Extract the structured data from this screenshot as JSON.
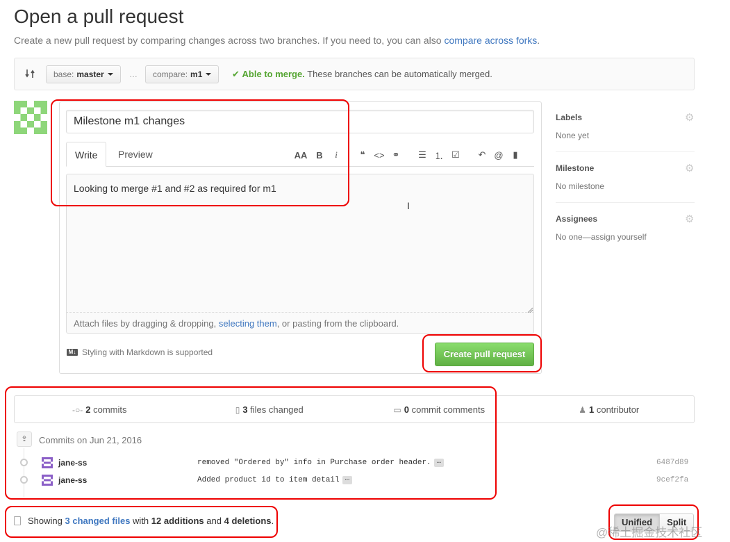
{
  "page": {
    "title": "Open a pull request",
    "subtitle_prefix": "Create a new pull request by comparing changes across two branches. If you need to, you can also",
    "subtitle_link": "compare across forks",
    "subtitle_suffix": "."
  },
  "range": {
    "base_label": "base:",
    "base_value": "master",
    "dots": "…",
    "compare_label": "compare:",
    "compare_value": "m1",
    "merge_status": "Able to merge.",
    "merge_detail": "These branches can be automatically merged.",
    "merge_check": "✔"
  },
  "form": {
    "title_value": "Milestone m1 changes",
    "tabs": [
      "Write",
      "Preview"
    ],
    "body_value": "Looking to merge #1 and #2 as required for m1",
    "attach_prefix": "Attach files by dragging & dropping,",
    "attach_link": "selecting them",
    "attach_suffix": ", or pasting from the clipboard.",
    "markdown_note": "Styling with Markdown is supported",
    "markdown_badge": "M↓",
    "submit_label": "Create pull request",
    "toolbar": {
      "header": "AA",
      "bold": "B",
      "italic": "i",
      "quote": "❝",
      "code": "<>",
      "link": "⚭",
      "ul": "☰",
      "ol": "⒈",
      "tasks": "☑",
      "reply": "↶",
      "mention": "@",
      "bookmark": "▮"
    }
  },
  "sidebar": {
    "labels_title": "Labels",
    "labels_value": "None yet",
    "milestone_title": "Milestone",
    "milestone_value": "No milestone",
    "assignees_title": "Assignees",
    "assignees_value": "No one—assign yourself",
    "gear": "⚙"
  },
  "summary": {
    "commits_count": "2",
    "commits_label": "commits",
    "files_count": "3",
    "files_label": "files changed",
    "comments_count": "0",
    "comments_label": "commit comments",
    "contributors_count": "1",
    "contributors_label": "contributor"
  },
  "commits": {
    "heading": "Commits on Jun 21, 2016",
    "rows": [
      {
        "author": "jane-ss",
        "message": "removed \"Ordered by\" info in Purchase order header.",
        "sha": "6487d89"
      },
      {
        "author": "jane-ss",
        "message": "Added product id to item detail",
        "sha": "9cef2fa"
      }
    ],
    "ellipsis": "…"
  },
  "diffstat": {
    "prefix": "Showing",
    "files_link": "3 changed files",
    "with": "with",
    "additions": "12 additions",
    "and": "and",
    "deletions": "4 deletions",
    "period": "."
  },
  "view_toggle": {
    "unified": "Unified",
    "split": "Split"
  },
  "watermark": "@稀土掘金技术社区",
  "colors": {
    "link": "#4078c0",
    "merge_ok": "#55a532",
    "primary_button": "#60b044",
    "annotation_red": "#ee0000",
    "avatar_green": "#8ed67a",
    "avatar_purple": "#8b5fc7"
  }
}
